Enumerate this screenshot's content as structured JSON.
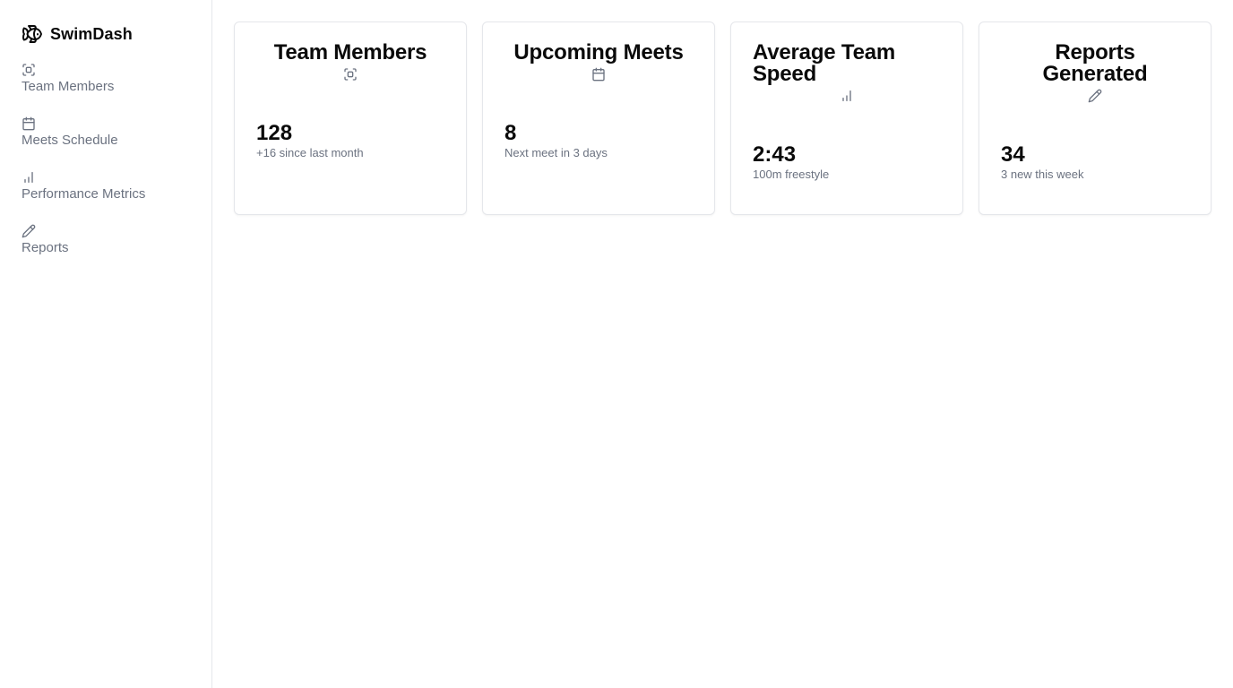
{
  "app": {
    "name": "SwimDash",
    "logo_icon": "fish-icon"
  },
  "sidebar": {
    "items": [
      {
        "label": "Team Members",
        "icon": "scan-face-icon"
      },
      {
        "label": "Meets Schedule",
        "icon": "calendar-icon"
      },
      {
        "label": "Performance Metrics",
        "icon": "bar-chart-icon"
      },
      {
        "label": "Reports",
        "icon": "pencil-icon"
      }
    ]
  },
  "cards": [
    {
      "title": "Team Members",
      "icon": "scan-face-icon",
      "value": "128",
      "subtitle": "+16 since last month"
    },
    {
      "title": "Upcoming Meets",
      "icon": "calendar-icon",
      "value": "8",
      "subtitle": "Next meet in 3 days"
    },
    {
      "title": "Average Team Speed",
      "icon": "bar-chart-icon",
      "value": "2:43",
      "subtitle": "100m freestyle"
    },
    {
      "title": "Reports Generated",
      "icon": "pencil-icon",
      "value": "34",
      "subtitle": "3 new this week"
    }
  ],
  "colors": {
    "muted_text": "#6b7280",
    "border": "#e5e7eb",
    "text": "#0a0a0a"
  }
}
